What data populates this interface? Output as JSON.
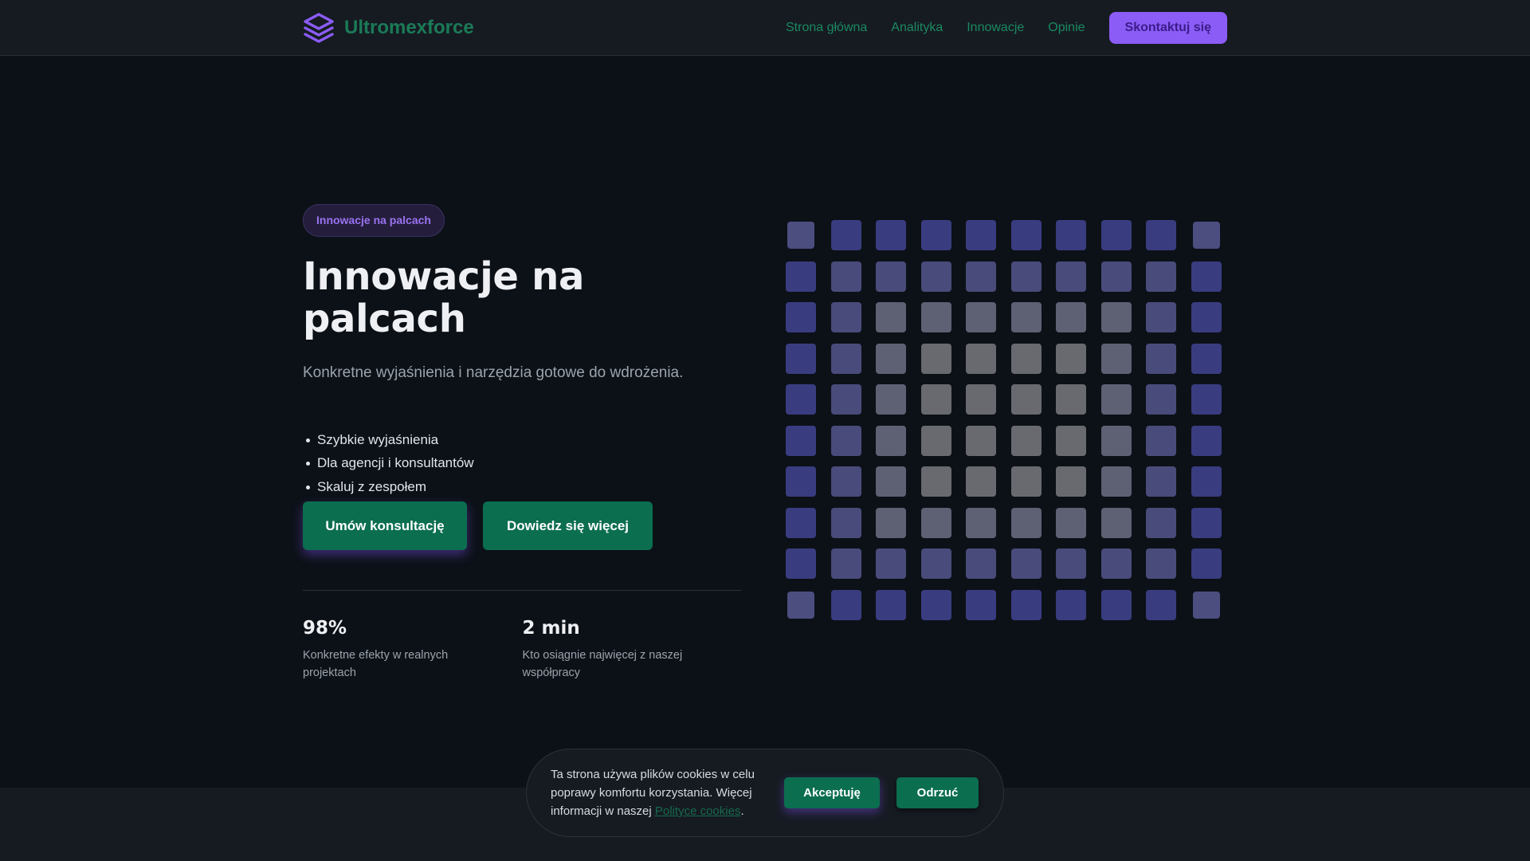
{
  "brand": {
    "name": "Ultromexforce",
    "logo_icon": "layers-icon",
    "logo_color": "#8b5cf6",
    "text_color": "#1b7b57"
  },
  "nav": {
    "items": [
      "Strona główna",
      "Analityka",
      "Innowacje",
      "Opinie"
    ],
    "cta_label": "Skontaktuj się"
  },
  "hero": {
    "badge": "Innowacje na palcach",
    "title": "Innowacje na palcach",
    "subtitle": "Konkretne wyjaśnienia i narzędzia gotowe do wdrożenia.",
    "bullets": [
      "Szybkie wyjaśnienia",
      "Dla agencji i konsultantów",
      "Skaluj z zespołem"
    ],
    "primary_cta": "Umów konsultację",
    "secondary_cta": "Dowiedz się więcej"
  },
  "stats": [
    {
      "value": "98%",
      "label": "Konkretne efekty w realnych projektach"
    },
    {
      "value": "2 min",
      "label": "Kto osiągnie najwięcej z naszej współpracy"
    }
  ],
  "decor_grid": {
    "rows": 10,
    "cols": 10
  },
  "cookie": {
    "text": "Ta strona używa plików cookies w celu poprawy komfortu korzystania. Więcej informacji w naszej",
    "link_text": "Polityce cookies",
    "suffix": ".",
    "accept_label": "Akceptuję",
    "reject_label": "Odrzuć"
  },
  "colors": {
    "accent": "#8b5cf6",
    "primary_button": "#0b6e4f",
    "background": "#0c1117",
    "surface": "#161b22"
  }
}
